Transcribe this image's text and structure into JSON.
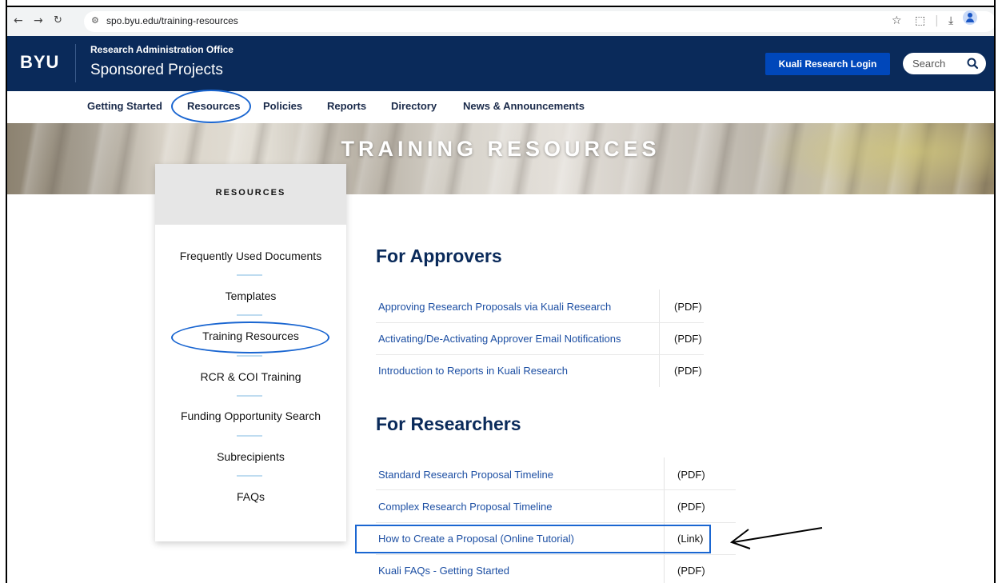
{
  "browser": {
    "url": "spo.byu.edu/training-resources"
  },
  "header": {
    "logo": "BYU",
    "office": "Research Administration Office",
    "title": "Sponsored Projects",
    "login_label": "Kuali Research Login",
    "search_placeholder": "Search"
  },
  "nav": {
    "items": [
      "Getting Started",
      "Resources",
      "Policies",
      "Reports",
      "Directory",
      "News & Announcements"
    ]
  },
  "hero": {
    "title": "TRAINING RESOURCES"
  },
  "sidebar": {
    "heading": "RESOURCES",
    "items": [
      "Frequently Used Documents",
      "Templates",
      "Training Resources",
      "RCR & COI Training",
      "Funding Opportunity Search",
      "Subrecipients",
      "FAQs"
    ]
  },
  "approvers": {
    "title": "For Approvers",
    "docs": [
      {
        "label": "Approving Research Proposals via Kuali Research",
        "type": "(PDF)"
      },
      {
        "label": "Activating/De-Activating Approver Email Notifications",
        "type": "(PDF)"
      },
      {
        "label": "Introduction to Reports in Kuali Research",
        "type": "(PDF)"
      }
    ]
  },
  "researchers": {
    "title": "For Researchers",
    "docs": [
      {
        "label": "Standard Research Proposal Timeline",
        "type": "(PDF)"
      },
      {
        "label": "Complex Research Proposal Timeline",
        "type": "(PDF)"
      },
      {
        "label": "How to Create a Proposal (Online Tutorial)",
        "type": "(Link)"
      },
      {
        "label": "Kuali FAQs - Getting Started",
        "type": "(PDF)"
      }
    ]
  },
  "colors": {
    "header_bg": "#0a2a5a",
    "login_btn": "#0047ba",
    "link": "#1d4fa3",
    "annotation": "#1a66d1"
  }
}
